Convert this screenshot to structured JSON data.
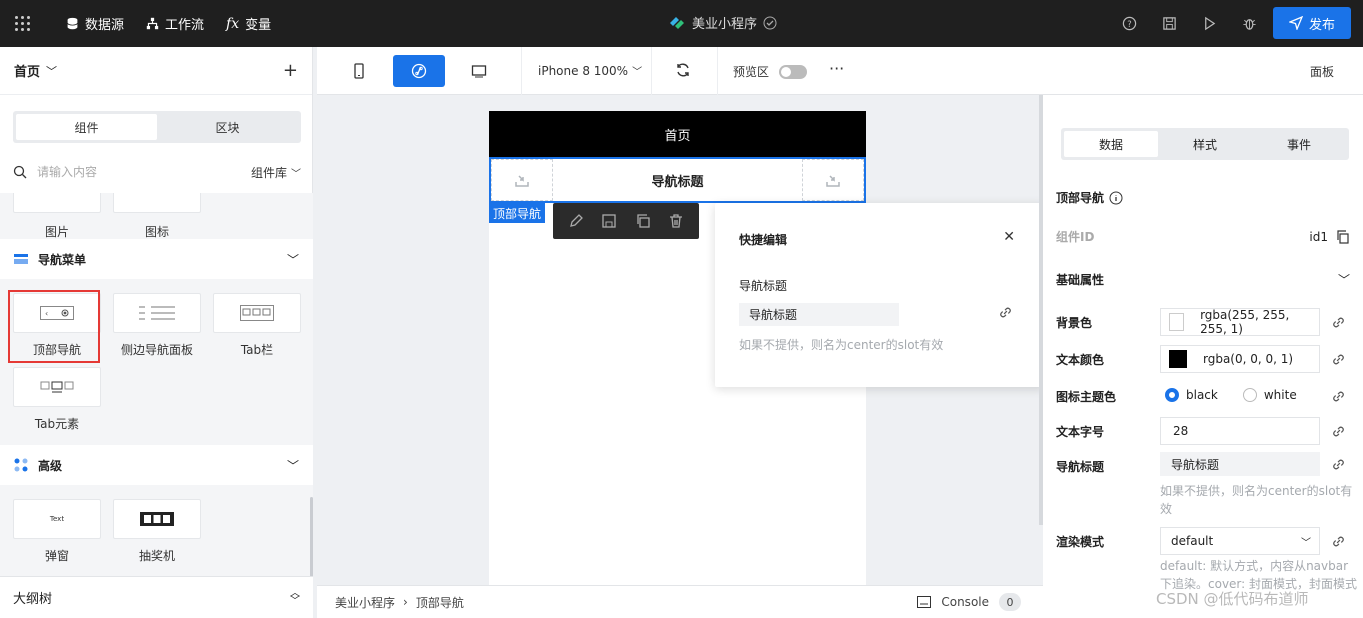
{
  "topbar": {
    "datasource": "数据源",
    "workflow": "工作流",
    "variables": "变量",
    "app_title": "美业小程序",
    "publish": "发布"
  },
  "left": {
    "page": "首页",
    "tabs": [
      "组件",
      "区块"
    ],
    "search_placeholder": "请输入内容",
    "library": "组件库",
    "partial": [
      "图片",
      "图标"
    ],
    "cat_nav": "导航菜单",
    "nav_items": [
      "顶部导航",
      "侧边导航面板",
      "Tab栏",
      "Tab元素"
    ],
    "cat_adv": "高级",
    "popup_text": "Text",
    "adv_items": [
      "弹窗",
      "抽奖机"
    ],
    "outline": "大纲树"
  },
  "toolbar": {
    "device": "iPhone 8 100%",
    "preview": "预览区",
    "panel": "面板"
  },
  "canvas": {
    "phone_title": "首页",
    "nav_title": "导航标题",
    "nav_tag": "顶部导航"
  },
  "quick": {
    "title": "快捷编辑",
    "label": "导航标题",
    "value": "导航标题",
    "hint": "如果不提供，则名为center的slot有效"
  },
  "status": {
    "crumb1": "美业小程序",
    "crumb2": "顶部导航",
    "console": "Console",
    "count": "0"
  },
  "right": {
    "tabs": [
      "数据",
      "样式",
      "事件"
    ],
    "section": "顶部导航",
    "comp_id_label": "组件ID",
    "comp_id": "id1",
    "basic": "基础属性",
    "bg_label": "背景色",
    "bg_value": "rgba(255, 255, 255, 1)",
    "text_color_label": "文本颜色",
    "text_color_value": "rgba(0, 0, 0, 1)",
    "icon_theme_label": "图标主题色",
    "icon_black": "black",
    "icon_white": "white",
    "font_size_label": "文本字号",
    "font_size": "28",
    "nav_title_label": "导航标题",
    "nav_title": "导航标题",
    "nav_hint": "如果不提供，则名为center的slot有效",
    "render_label": "渲染模式",
    "render_value": "default",
    "render_hint": "default: 默认方式，内容从navbar下追染。cover: 封面模式，封面模式"
  },
  "watermark": "CSDN @低代码布道师",
  "colors": {
    "accent": "#1a73e8",
    "topbar": "#1f1f1f",
    "highlight": "#e53935"
  }
}
